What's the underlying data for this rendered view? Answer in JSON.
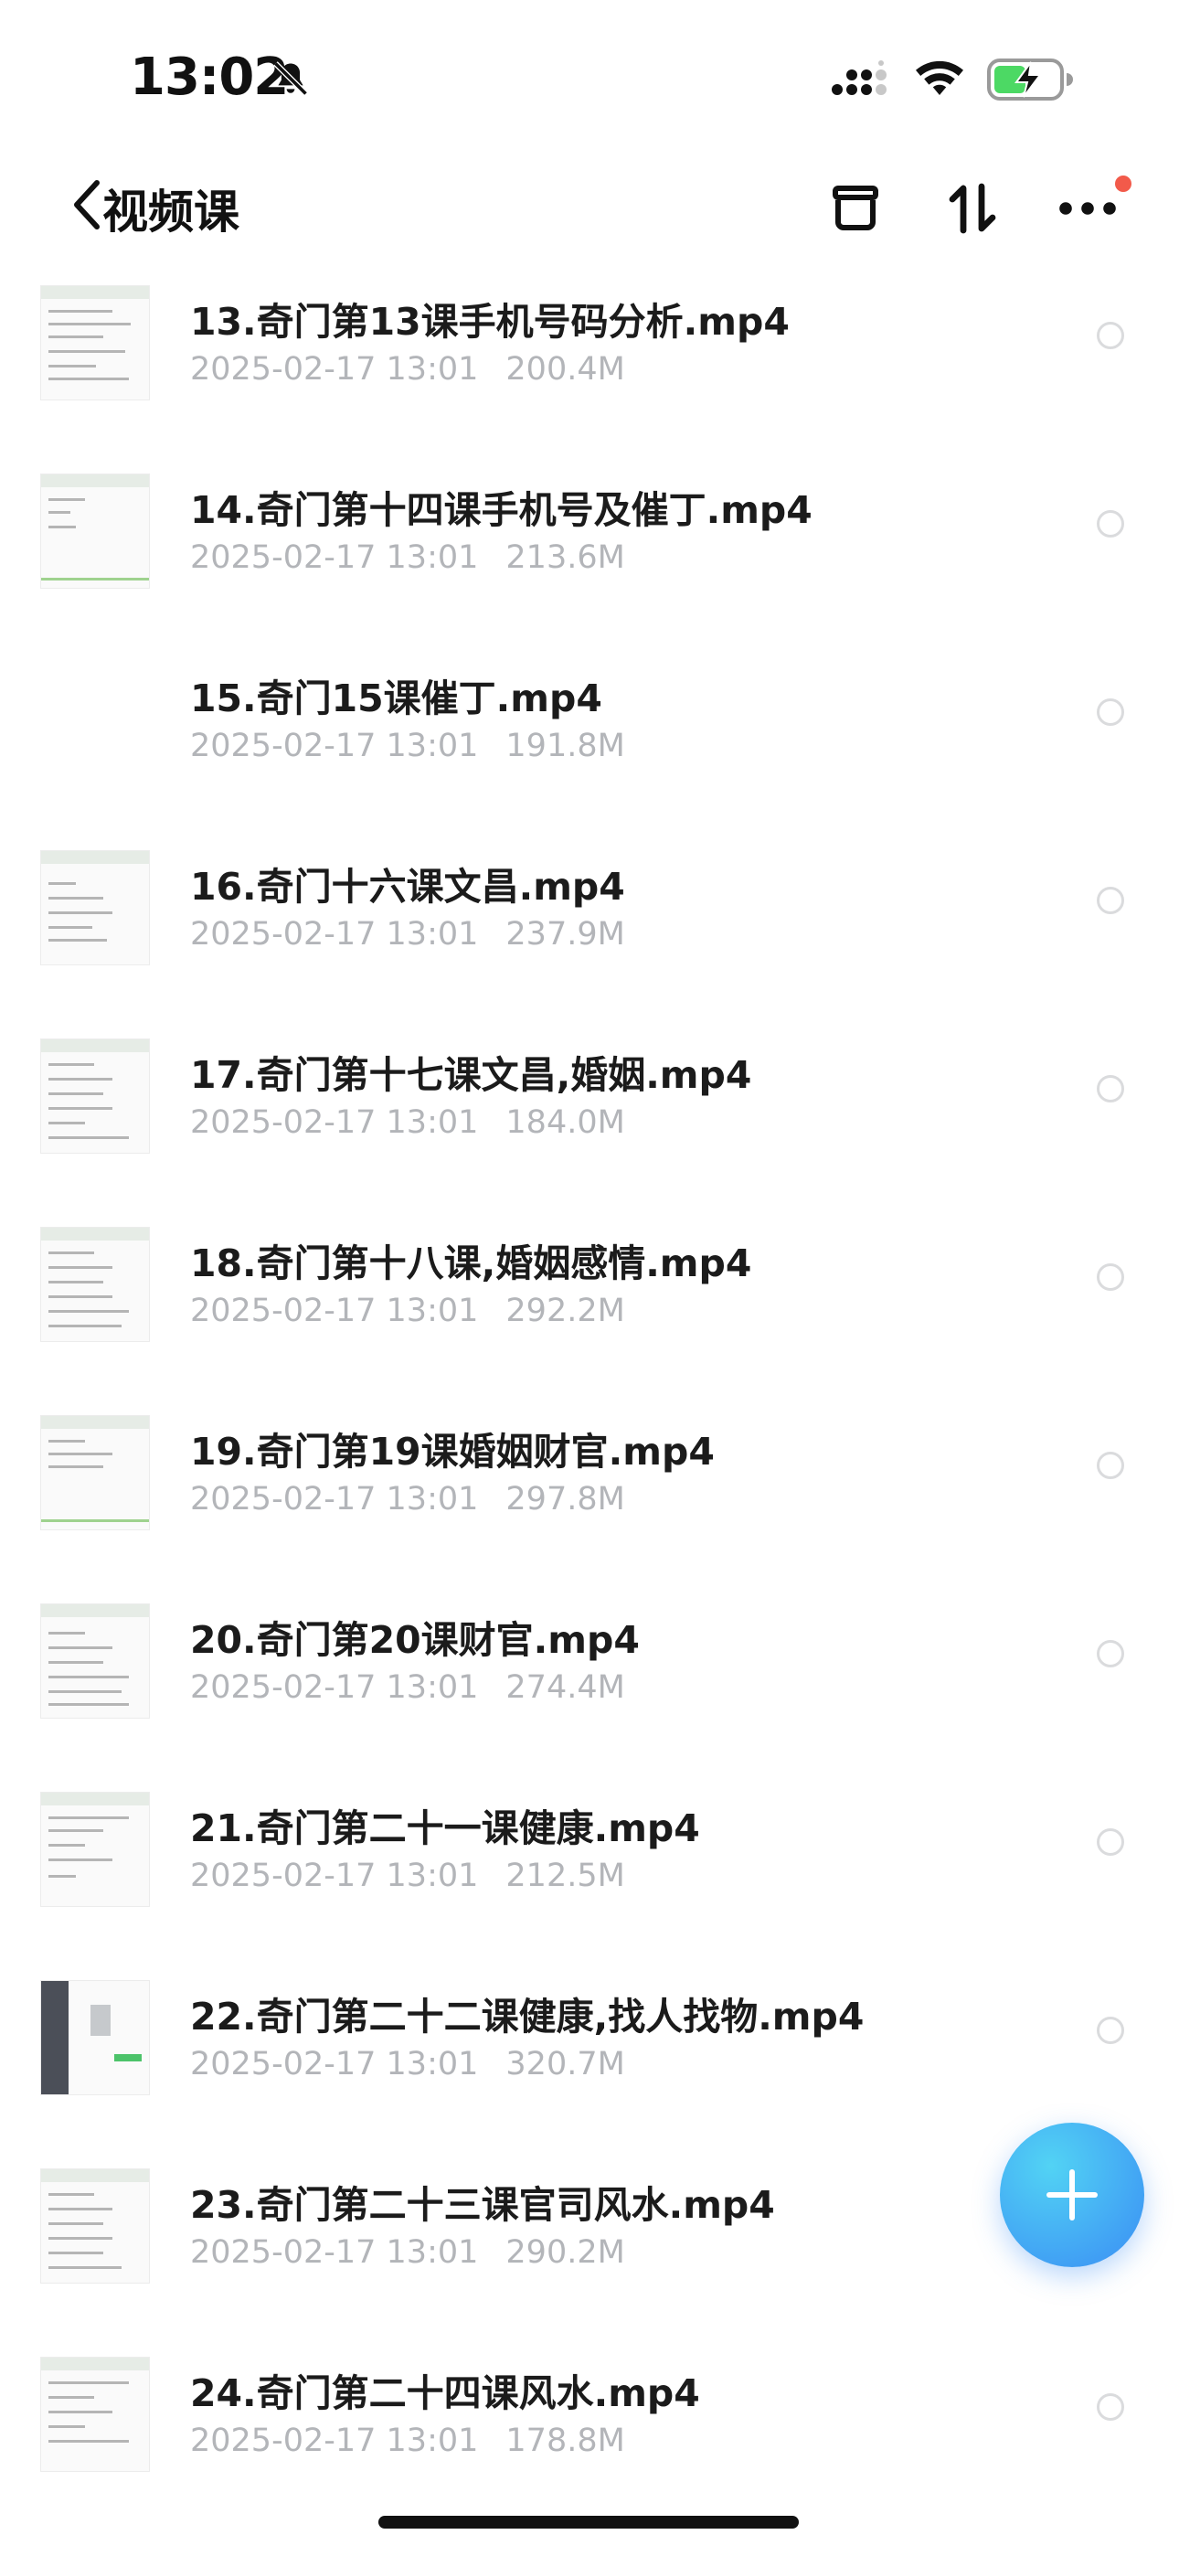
{
  "status_bar": {
    "time": "13:02"
  },
  "header": {
    "back_label": "视频课"
  },
  "files": [
    {
      "name": "13.奇门第13课手机号码分析.mp4",
      "date": "2025-02-17 13:01",
      "size": "200.4M"
    },
    {
      "name": "14.奇门第十四课手机号及催丁.mp4",
      "date": "2025-02-17 13:01",
      "size": "213.6M"
    },
    {
      "name": "15.奇门15课催丁.mp4",
      "date": "2025-02-17 13:01",
      "size": "191.8M"
    },
    {
      "name": "16.奇门十六课文昌.mp4",
      "date": "2025-02-17 13:01",
      "size": "237.9M"
    },
    {
      "name": "17.奇门第十七课文昌,婚姻.mp4",
      "date": "2025-02-17 13:01",
      "size": "184.0M"
    },
    {
      "name": "18.奇门第十八课,婚姻感情.mp4",
      "date": "2025-02-17 13:01",
      "size": "292.2M"
    },
    {
      "name": "19.奇门第19课婚姻财官.mp4",
      "date": "2025-02-17 13:01",
      "size": "297.8M"
    },
    {
      "name": "20.奇门第20课财官.mp4",
      "date": "2025-02-17 13:01",
      "size": "274.4M"
    },
    {
      "name": "21.奇门第二十一课健康.mp4",
      "date": "2025-02-17 13:01",
      "size": "212.5M"
    },
    {
      "name": "22.奇门第二十二课健康,找人找物.mp4",
      "date": "2025-02-17 13:01",
      "size": "320.7M"
    },
    {
      "name": "23.奇门第二十三课官司风水.mp4",
      "date": "2025-02-17 13:01",
      "size": "290.2M"
    },
    {
      "name": "24.奇门第二十四课风水.mp4",
      "date": "2025-02-17 13:01",
      "size": "178.8M"
    }
  ],
  "colors": {
    "accent": "#3a8df4",
    "notification_dot": "#f25a4a",
    "meta_text": "#b3b5b9"
  },
  "icons": [
    "bell-muted-icon",
    "cellular-signal-icon",
    "wifi-icon",
    "battery-charging-icon",
    "chevron-left-icon",
    "box-icon",
    "sort-icon",
    "more-icon",
    "plus-icon"
  ]
}
